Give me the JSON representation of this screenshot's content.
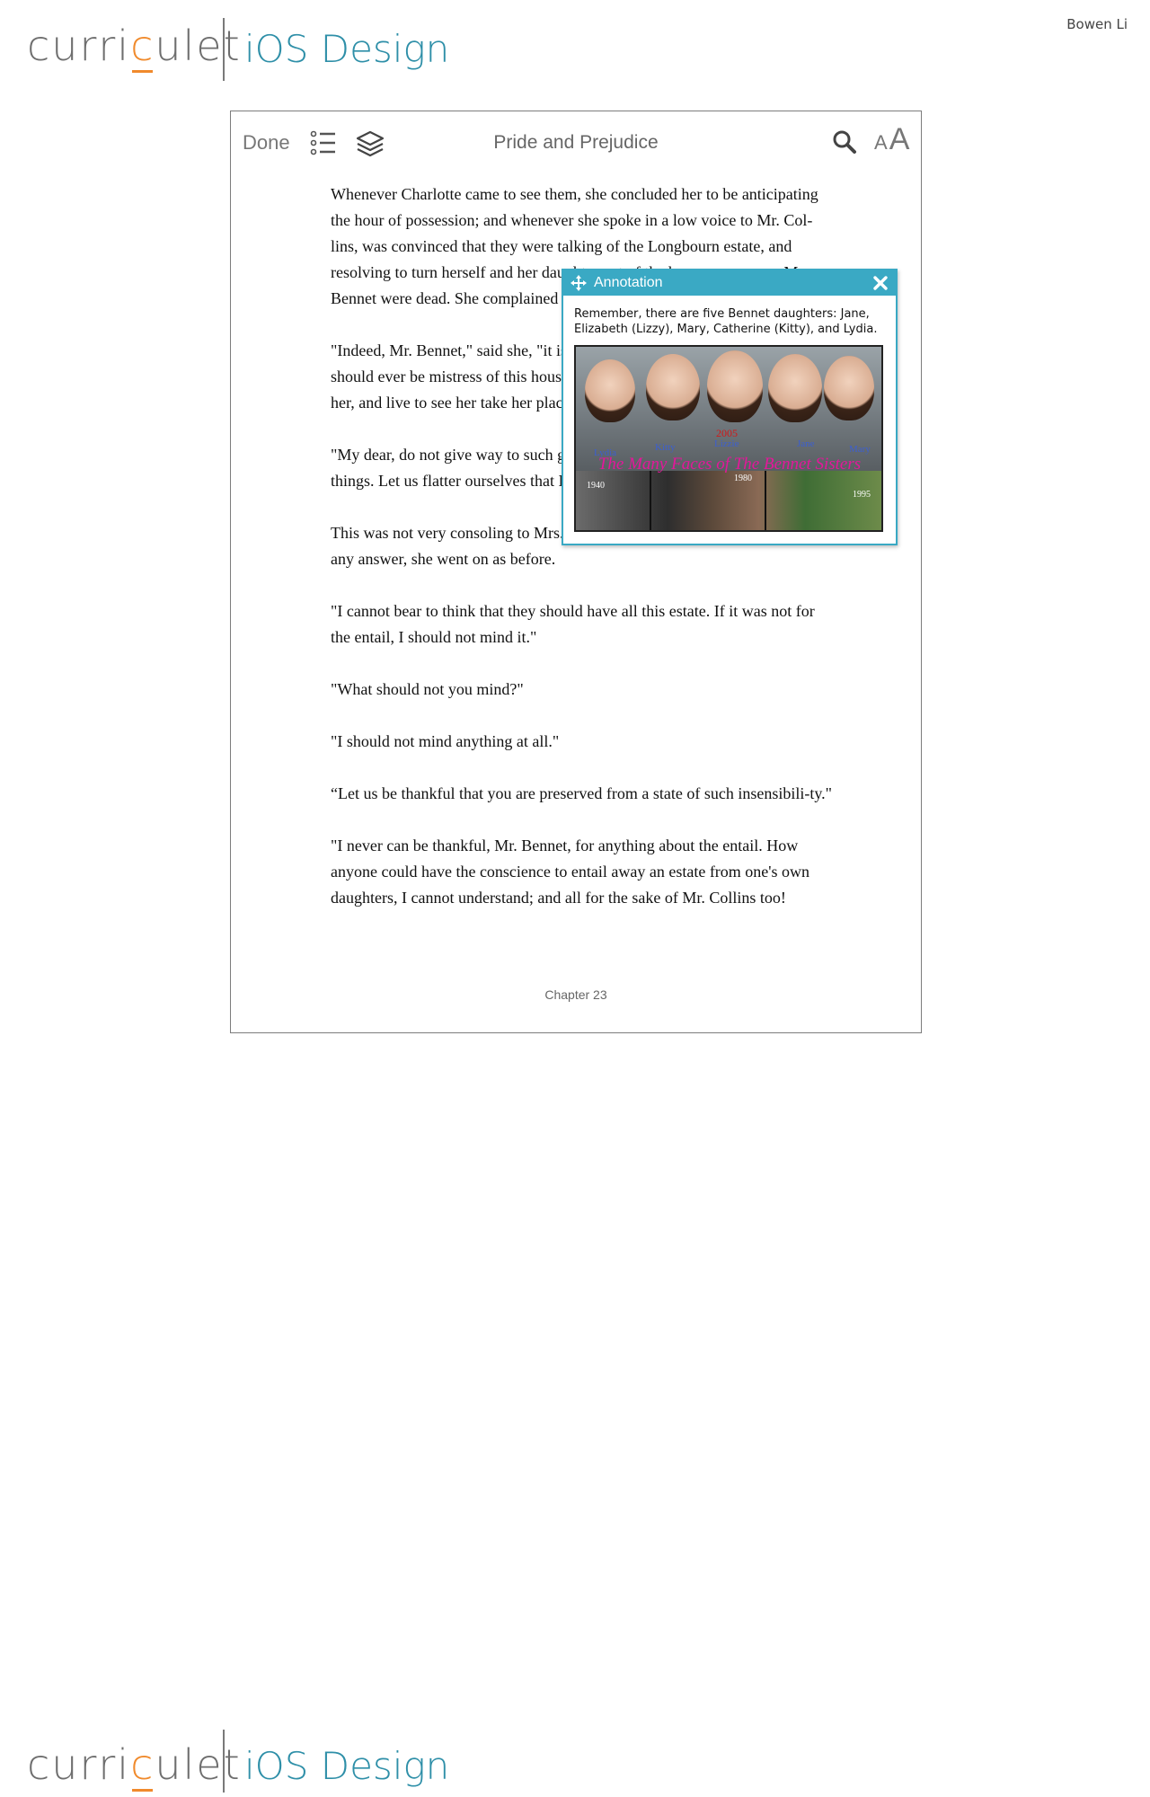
{
  "header": {
    "logo_prefix": "curri",
    "logo_accent": "c",
    "logo_suffix": "ulet",
    "subtitle": "iOS Design",
    "author": "Bowen Li"
  },
  "footer": {
    "logo_prefix": "curri",
    "logo_accent": "c",
    "logo_suffix": "ulet",
    "subtitle": "iOS Design"
  },
  "toolbar": {
    "done_label": "Done",
    "title": "Pride and Prejudice",
    "font_small": "A",
    "font_large": "A",
    "icons": [
      "list-icon",
      "layers-icon",
      "search-icon"
    ]
  },
  "page": {
    "paragraphs": [
      "Whenever Charlotte came to see them, she concluded her to be anticipating the hour of possession; and whenever she spoke in a low voice to Mr. Col-lins, was convinced that they were talking of the Longbourn estate, and resolving to turn herself and her daughter out of the house, as soon as Mr. Bennet were dead. She complained bitterly of all this to her husband.",
      "\"Indeed, Mr. Bennet,\" said she, \"it is very hard to think that Charlotte Lucas should ever be mistress of this house, that I should be forced to make way for her, and live to see her take her place in it!\"",
      "\"My dear, do not give way to such gloomy thoughts. Let us hope for better things. Let us flatter ourselves that I may be the survivor.\"",
      "This was not very consoling to Mrs. Bennet, and therefore, instead of making any answer, she went on as before.",
      "\"I cannot bear to think that they should have all this estate. If it was not for the entail, I should not mind it.\"",
      "\"What should not you mind?\"",
      "\"I should not mind anything at all.\"",
      "“Let us be thankful that you are preserved from a state of such insensibili-ty.\"",
      "\"I never can be thankful, Mr. Bennet, for anything about the entail. How anyone could have the conscience to entail away an estate from one's own daughters, I cannot understand; and all for the sake of Mr. Collins too!"
    ],
    "chapter": "Chapter 23"
  },
  "annotation": {
    "title": "Annotation",
    "body": "Remember, there are five Bennet daughters: Jane, Elizabeth (Lizzy), Mary, Catherine (Kitty), and Lydia.",
    "image": {
      "caption": "The Many Faces of The Bennet Sisters",
      "names": [
        "Lydia",
        "Kitty",
        "Lizzie",
        "Jane",
        "Mary"
      ],
      "years": [
        "2005",
        "1940",
        "1980",
        "1995"
      ]
    }
  },
  "colors": {
    "accent": "#3aa9c4",
    "brand_blue": "#2e8fa8",
    "logo_orange": "#f08a2c",
    "caption_pink": "#e3179a"
  }
}
